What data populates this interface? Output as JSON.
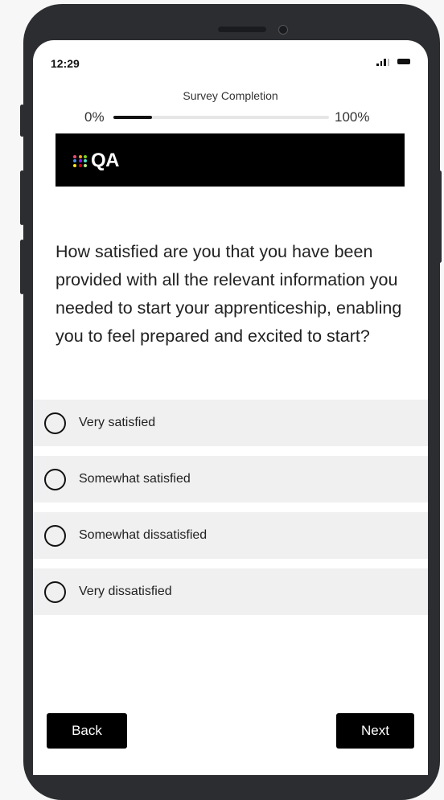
{
  "status_bar": {
    "time": "12:29",
    "icons": [
      "signal-icon",
      "battery-icon"
    ]
  },
  "progress": {
    "title": "Survey Completion",
    "start_label": "0%",
    "end_label": "100%",
    "value_fraction": 0.18
  },
  "brand": {
    "logo_text": "QA",
    "logo_dot_colors": [
      "#e94e77",
      "#f5a623",
      "#7ed321",
      "#4a90e2",
      "#9013fe",
      "#50e3c2",
      "#f8e71c",
      "#d0021b",
      "#b8e986"
    ]
  },
  "question": {
    "text": "How satisfied are you that you have been provided with all the relevant information you needed to start your apprenticeship, enabling you to feel prepared and excited to start?"
  },
  "options": [
    {
      "label": "Very satisfied"
    },
    {
      "label": "Somewhat satisfied"
    },
    {
      "label": "Somewhat dissatisfied"
    },
    {
      "label": "Very dissatisfied"
    }
  ],
  "navigation": {
    "back_label": "Back",
    "next_label": "Next"
  }
}
